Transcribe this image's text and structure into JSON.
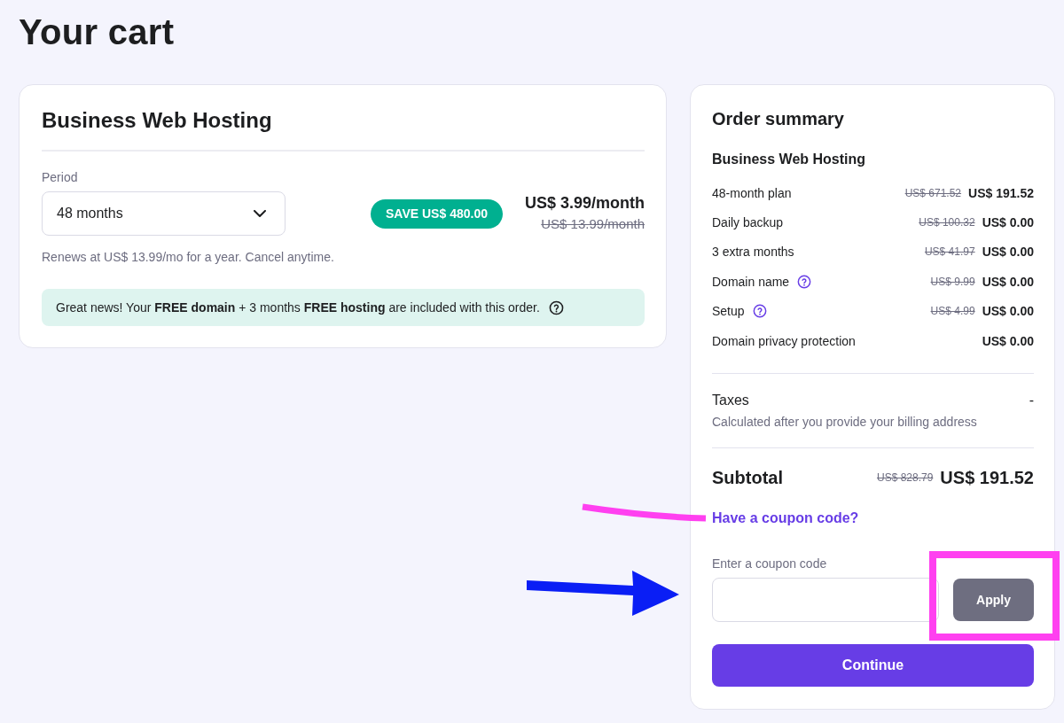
{
  "page_title": "Your cart",
  "product": {
    "title": "Business Web Hosting",
    "period_label": "Period",
    "period_select": {
      "value": "48 months"
    },
    "save_badge": "SAVE US$ 480.00",
    "price": "US$ 3.99/month",
    "old_price": "US$ 13.99/month",
    "renewal_note": "Renews at US$ 13.99/mo for a year. Cancel anytime.",
    "promo_banner": "Great news! Your **FREE domain** + 3 months **FREE hosting** are included with this order."
  },
  "summary": {
    "title": "Order summary",
    "product": "Business Web Hosting",
    "lines": [
      {
        "label": "48-month plan",
        "help": false,
        "old_price": "US$ 671.52",
        "price": "US$ 191.52"
      },
      {
        "label": "Daily backup",
        "help": false,
        "old_price": "US$ 100.32",
        "price": "US$ 0.00"
      },
      {
        "label": "3 extra months",
        "help": false,
        "old_price": "US$ 41.97",
        "price": "US$ 0.00"
      },
      {
        "label": "Domain name",
        "help": true,
        "old_price": "US$ 9.99",
        "price": "US$ 0.00"
      },
      {
        "label": "Setup",
        "help": true,
        "old_price": "US$ 4.99",
        "price": "US$ 0.00"
      },
      {
        "label": "Domain privacy protection",
        "help": false,
        "price": "US$ 0.00"
      }
    ],
    "taxes": {
      "label": "Taxes",
      "value": "-",
      "note": "Calculated after you provide your billing address"
    },
    "subtotal": {
      "label": "Subtotal",
      "old_price": "US$ 828.79",
      "price": "US$ 191.52"
    },
    "coupon": {
      "link": "Have a coupon code?",
      "label": "Enter a coupon code",
      "apply_button": {
        "label": "Apply",
        "disabled": true
      }
    },
    "continue_button": "Continue"
  },
  "annotations": [
    {
      "kind": "line",
      "color": "#ff40f0"
    },
    {
      "kind": "arrow",
      "color": "#0a1ef5"
    },
    {
      "kind": "frame",
      "color": "#ff40f0"
    }
  ]
}
